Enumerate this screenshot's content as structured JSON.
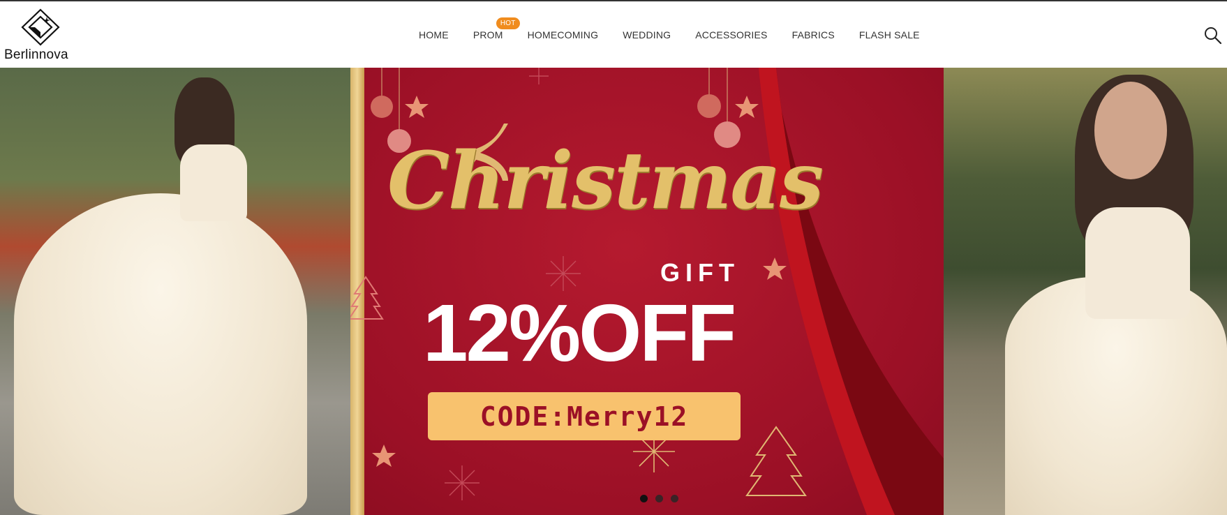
{
  "brand": {
    "name": "Berlinnova"
  },
  "nav": {
    "items": [
      {
        "label": "HOME"
      },
      {
        "label": "PROM",
        "badge": "HOT"
      },
      {
        "label": "HOMECOMING"
      },
      {
        "label": "WEDDING"
      },
      {
        "label": "ACCESSORIES"
      },
      {
        "label": "FABRICS"
      },
      {
        "label": "FLASH SALE"
      }
    ]
  },
  "search": {
    "icon": "search-icon"
  },
  "banner": {
    "title": "Christmas",
    "gift": "GIFT",
    "discount": "12%OFF",
    "code": "CODE:Merry12",
    "slides": 3,
    "active_slide": 1,
    "colors": {
      "accent": "#f08c1e",
      "promo_red": "#9b1026",
      "gold": "#e3c06a",
      "code_bg": "#f8c26e"
    }
  }
}
